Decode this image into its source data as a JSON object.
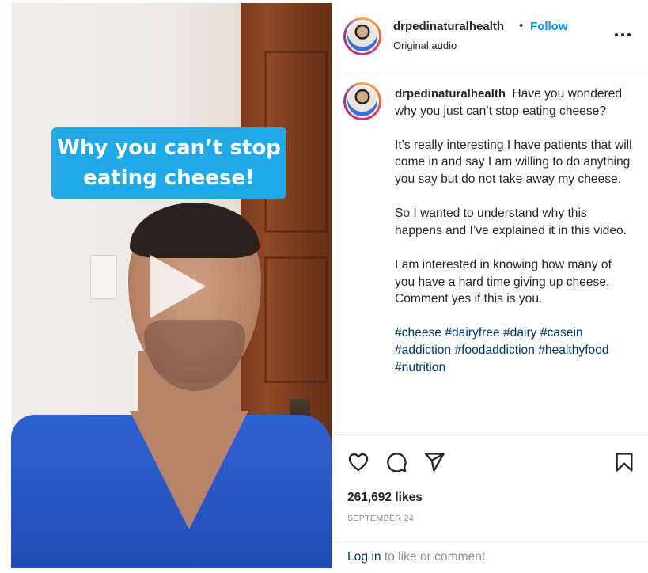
{
  "media": {
    "caption_line1": "Why you can’t stop",
    "caption_line2": "eating cheese!",
    "play_icon": "play-icon",
    "caption_bg_color": "#1fa9e8"
  },
  "header": {
    "username": "drpedinaturalhealth",
    "separator": "•",
    "follow_label": "Follow",
    "audio": "Original audio",
    "more_icon": "more-icon"
  },
  "post": {
    "username": "drpedinaturalhealth",
    "paragraphs": [
      "Have you wondered why you just can’t stop eating cheese?",
      "It’s really interesting I have patients that will come in and say I am willing to do anything you say but do not take away my cheese.",
      "So I wanted to understand why this happens and I’ve explained it in this video.",
      "I am interested in knowing how many of you have a hard time giving up cheese. Comment yes if this is you."
    ],
    "hashtags": [
      "#cheese",
      "#dairyfree",
      "#dairy",
      "#casein",
      "#addiction",
      "#foodaddiction",
      "#healthyfood",
      "#nutrition"
    ]
  },
  "actions": {
    "icons": [
      "heart-icon",
      "comment-icon",
      "share-icon",
      "bookmark-icon"
    ],
    "likes": "261,692 likes",
    "date": "SEPTEMBER 24",
    "login_link": "Log in",
    "login_rest": " to like or comment."
  },
  "colors": {
    "follow": "#0095f6",
    "hashtag": "#00376b",
    "muted": "#8e8e8e"
  }
}
